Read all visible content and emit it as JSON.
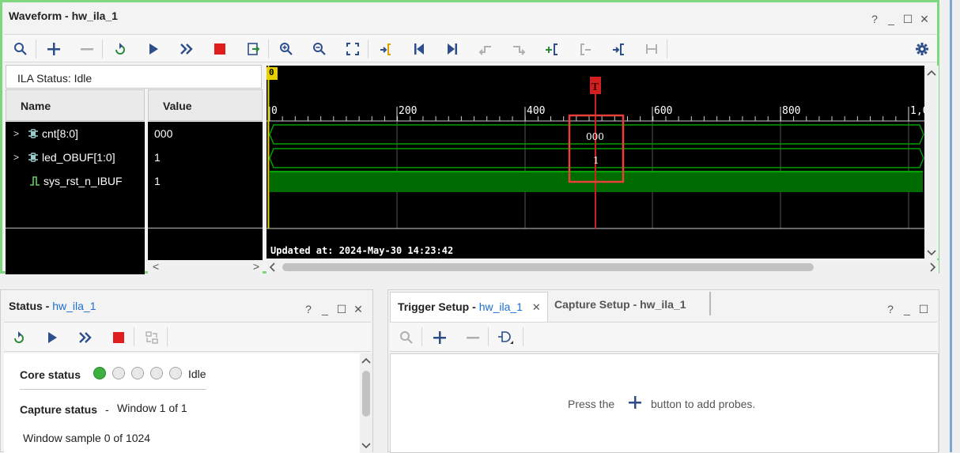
{
  "waveform": {
    "title": "Waveform - hw_ila_1",
    "window_controls": [
      "?",
      "_",
      "☐",
      "✕"
    ],
    "toolbar_icons": [
      "search-icon",
      "add-icon",
      "remove-icon",
      "run-trigger-immediate-icon",
      "run-trigger-icon",
      "auto-rerun-icon",
      "stop-trigger-icon",
      "export-icon",
      "zoom-in-icon",
      "zoom-out-icon",
      "zoom-fit-icon",
      "goto-cursor-icon",
      "goto-start-icon",
      "goto-end-icon",
      "prev-transition-icon",
      "next-transition-icon",
      "add-marker-icon",
      "prev-marker-icon",
      "next-marker-icon",
      "swap-cursors-icon",
      "settings-icon"
    ],
    "ila_status": "ILA Status:  Idle",
    "columns": {
      "name": "Name",
      "value": "Value"
    },
    "signals": [
      {
        "name": "cnt[8:0]",
        "value": "000",
        "expandable": true,
        "icon": "bus-icon"
      },
      {
        "name": "led_OBUF[1:0]",
        "value": "1",
        "expandable": true,
        "icon": "bus-icon"
      },
      {
        "name": "sys_rst_n_IBUF",
        "value": "1",
        "expandable": false,
        "icon": "bit-icon"
      }
    ],
    "timeline": {
      "origin_label": "0",
      "ticks": [
        "0",
        "200",
        "400",
        "600",
        "800",
        "1,0"
      ],
      "trigger_marker": "T",
      "bus_labels": [
        "000",
        "1"
      ],
      "updated_at": "Updated at: 2024-May-30 14:23:42"
    }
  },
  "status": {
    "title": "Status - ",
    "title_link": "hw_ila_1",
    "window_controls": [
      "?",
      "_",
      "☐",
      "✕"
    ],
    "toolbar_icons": [
      "run-trigger-immediate-icon",
      "run-trigger-icon",
      "auto-rerun-icon",
      "stop-trigger-icon",
      "capture-settings-icon"
    ],
    "core_status_label": "Core status",
    "core_status_value": "Idle",
    "capture_status_label": "Capture status",
    "capture_status_sep": "-",
    "capture_status_value": "Window 1 of 1",
    "window_sample": "Window sample 0 of 1024"
  },
  "trigger": {
    "tab_trigger": "Trigger Setup - ",
    "tab_trigger_link": "hw_ila_1",
    "tab_capture": "Capture Setup - hw_ila_1",
    "window_controls": [
      "?",
      "_",
      "☐"
    ],
    "toolbar_icons": [
      "search-icon",
      "add-icon",
      "remove-icon",
      "trigger-condition-icon"
    ],
    "empty_prefix": "Press the",
    "empty_suffix": "button to add probes."
  },
  "colors": {
    "accent_green": "#7ed67e",
    "wave_green": "#00a000",
    "trigger_red": "#d22020",
    "link_blue": "#1a6fd0"
  }
}
